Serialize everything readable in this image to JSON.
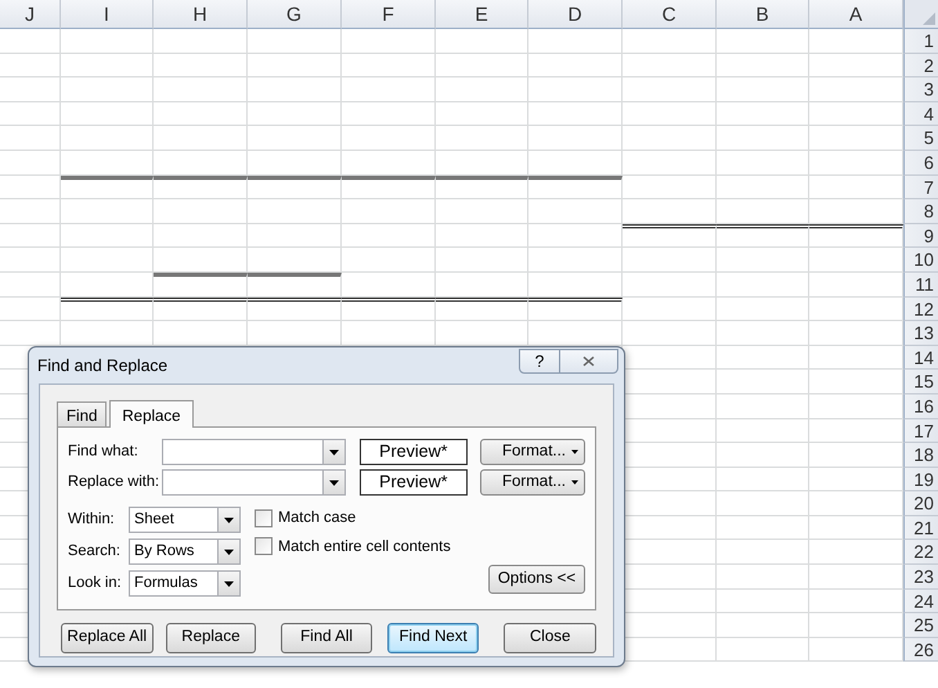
{
  "sheet": {
    "columns": [
      "J",
      "I",
      "H",
      "G",
      "F",
      "E",
      "D",
      "C",
      "B",
      "A"
    ],
    "rows": [
      {
        "label": "1"
      },
      {
        "label": "2"
      },
      {
        "label": "3"
      },
      {
        "label": "4"
      },
      {
        "label": "5"
      },
      {
        "label": "6"
      },
      {
        "label": "7",
        "top_border": {
          "kind": "thick",
          "cells": [
            false,
            true,
            true,
            true,
            true,
            true,
            true,
            false,
            false,
            false
          ]
        }
      },
      {
        "label": "8"
      },
      {
        "label": "9",
        "top_border": {
          "kind": "double",
          "cells": [
            false,
            false,
            false,
            false,
            false,
            false,
            false,
            true,
            true,
            true
          ]
        }
      },
      {
        "label": "10"
      },
      {
        "label": "11",
        "top_border": {
          "kind": "thick",
          "cells": [
            false,
            false,
            true,
            true,
            false,
            false,
            false,
            false,
            false,
            false
          ]
        }
      },
      {
        "label": "12",
        "top_border": {
          "kind": "double",
          "cells": [
            false,
            true,
            true,
            true,
            true,
            true,
            true,
            false,
            false,
            false
          ]
        }
      },
      {
        "label": "13"
      },
      {
        "label": "14"
      },
      {
        "label": "15"
      },
      {
        "label": "16"
      },
      {
        "label": "17"
      },
      {
        "label": "18"
      },
      {
        "label": "19"
      },
      {
        "label": "20"
      },
      {
        "label": "21"
      },
      {
        "label": "22"
      },
      {
        "label": "23"
      },
      {
        "label": "24"
      },
      {
        "label": "25"
      },
      {
        "label": "26"
      }
    ]
  },
  "dialog": {
    "title": "Find and Replace",
    "help_button": "?",
    "tabs": [
      {
        "label": "Find",
        "selected": false
      },
      {
        "label": "Replace",
        "selected": true
      }
    ],
    "fields": [
      {
        "label": "Find what:",
        "preview": "Preview*",
        "format_button": "Format..."
      },
      {
        "label": "Replace with:",
        "preview": "Preview*",
        "format_button": "Format..."
      }
    ],
    "selects": [
      {
        "label": "Within:",
        "value": "Sheet"
      },
      {
        "label": "Search:",
        "value": "By Rows"
      },
      {
        "label": "Look in:",
        "value": "Formulas"
      }
    ],
    "checkboxes": [
      {
        "label": "Match case",
        "checked": false
      },
      {
        "label": "Match entire cell contents",
        "checked": false
      }
    ],
    "options_button": "Options <<",
    "buttons": [
      {
        "label": "Replace All",
        "default": false
      },
      {
        "label": "Replace",
        "default": false
      },
      {
        "label": "Find All",
        "default": false
      },
      {
        "label": "Find Next",
        "default": true
      },
      {
        "label": "Close",
        "default": false
      }
    ]
  }
}
